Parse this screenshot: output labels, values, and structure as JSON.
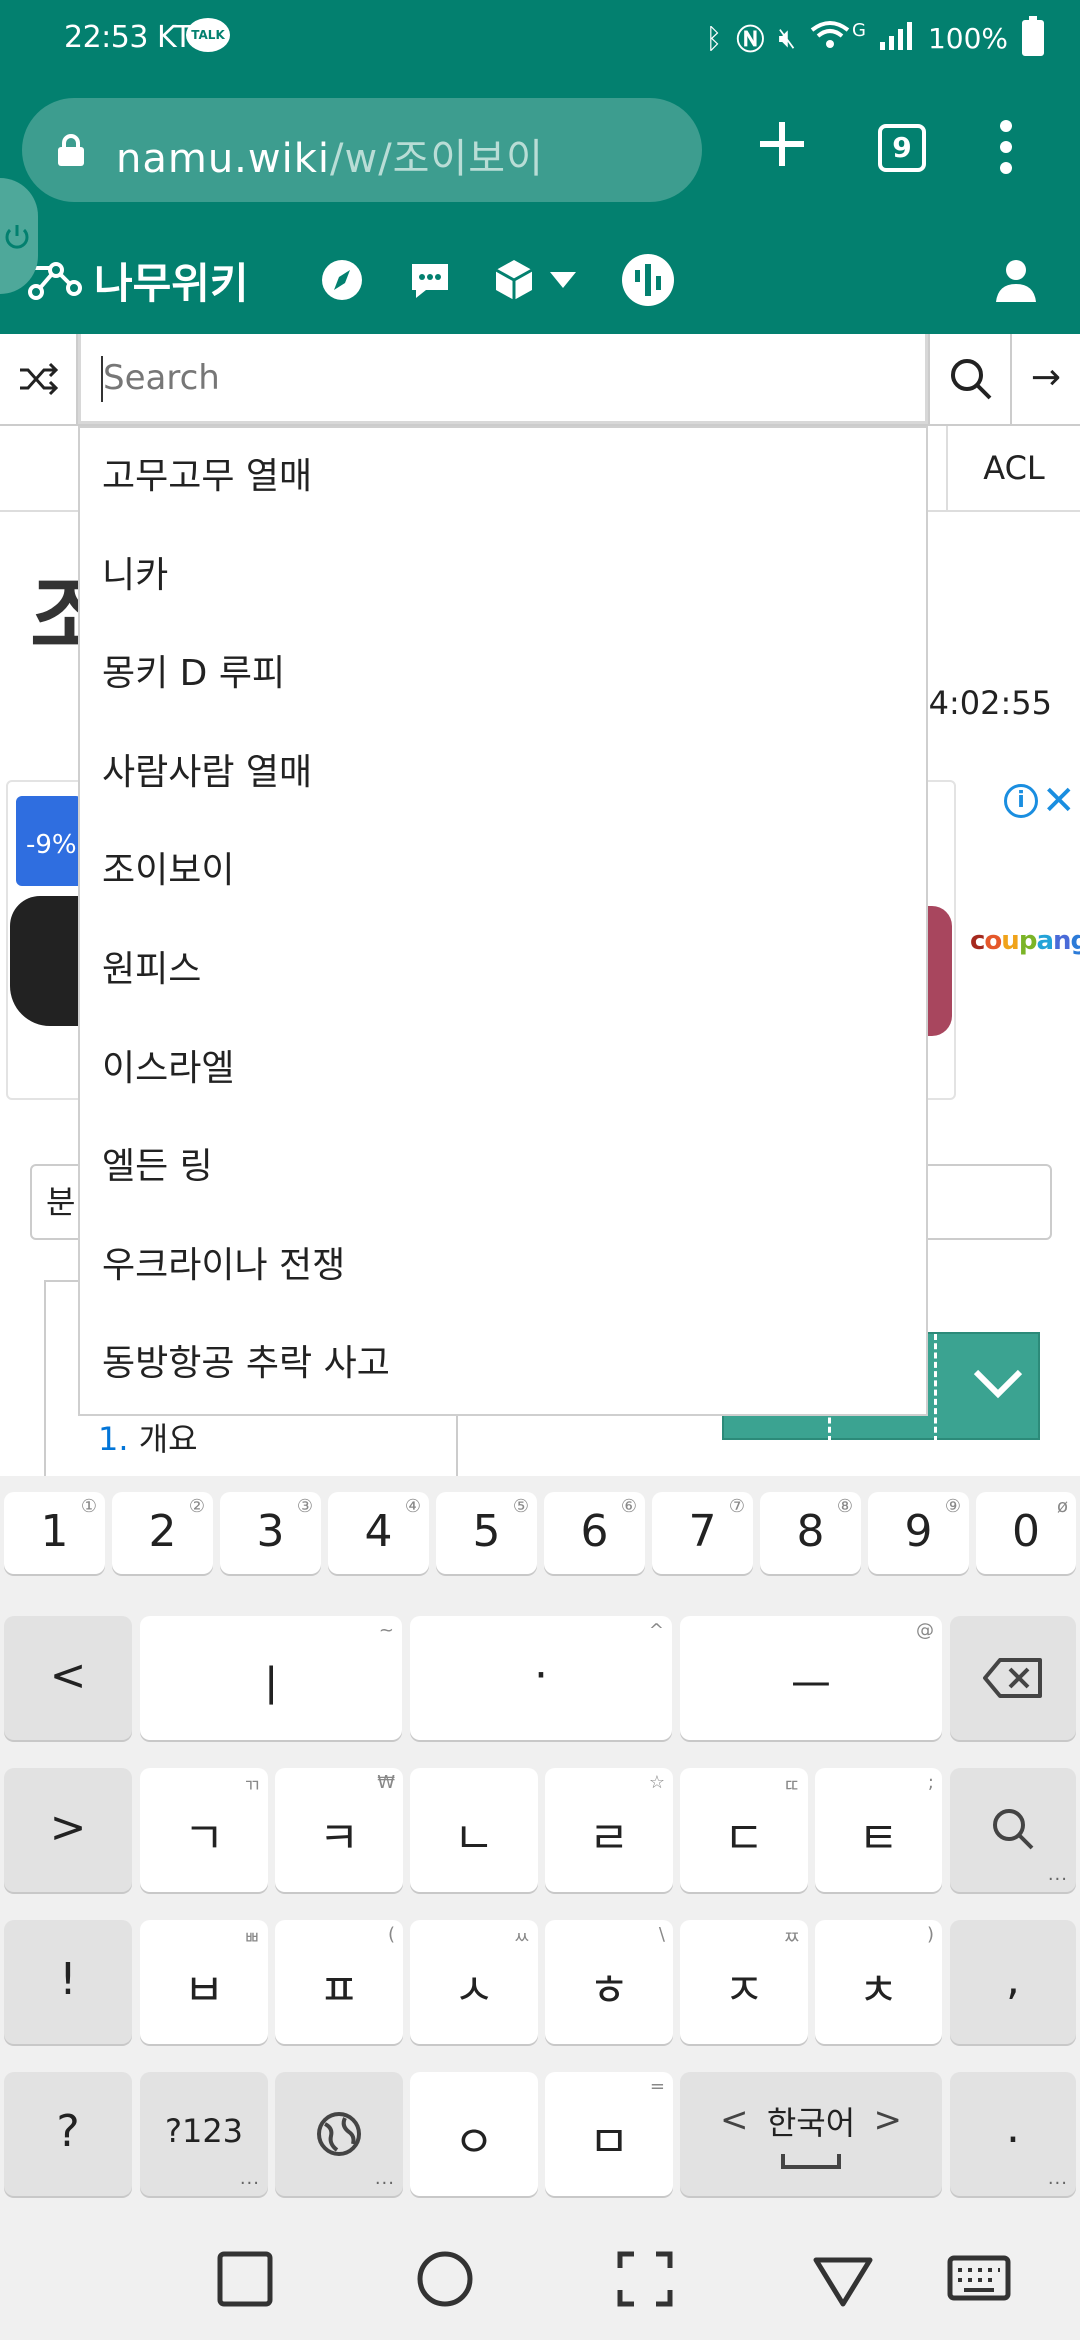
{
  "status_bar": {
    "time": "22:53",
    "carrier": "KT",
    "talk_badge": "TALK",
    "network_label": "G",
    "battery": "100%"
  },
  "browser": {
    "url_host": "namu.wiki",
    "url_path": "/w/조이보이",
    "tab_count": "9"
  },
  "wiki_nav": {
    "logo_text": "나무위키",
    "icons": [
      "compass-icon",
      "chat-icon",
      "cube-icon",
      "dropdown-caret-icon",
      "thetree-icon",
      "user-icon"
    ]
  },
  "search": {
    "placeholder": "Search",
    "value": "",
    "go_arrow": "→"
  },
  "page_behind": {
    "acl_label": "ACL",
    "title_partial": "조",
    "last_edit_time": "4:02:55",
    "category_partial": "분",
    "toc_first_number": "1.",
    "toc_first_label": "개요",
    "ad": {
      "discount": "-9%",
      "brand": [
        "c",
        "o",
        "u",
        "p",
        "a",
        "n",
        "g"
      ],
      "info": "i",
      "close": "✕"
    }
  },
  "suggestions": [
    "고무고무 열매",
    "니카",
    "몽키 D 루피",
    "사람사람 열매",
    "조이보이",
    "원피스",
    "이스라엘",
    "엘든 링",
    "우크라이나 전쟁",
    "동방항공 추락 사고"
  ],
  "keyboard": {
    "number_row": [
      {
        "label": "1",
        "hint": "①"
      },
      {
        "label": "2",
        "hint": "②"
      },
      {
        "label": "3",
        "hint": "③"
      },
      {
        "label": "4",
        "hint": "④"
      },
      {
        "label": "5",
        "hint": "⑤"
      },
      {
        "label": "6",
        "hint": "⑥"
      },
      {
        "label": "7",
        "hint": "⑦"
      },
      {
        "label": "8",
        "hint": "⑧"
      },
      {
        "label": "9",
        "hint": "⑨"
      },
      {
        "label": "0",
        "hint": "ø"
      }
    ],
    "row2": [
      {
        "label": "<",
        "hint": "",
        "dark": true
      },
      {
        "label": "ㅣ",
        "hint": "~"
      },
      {
        "label": "·",
        "hint": "^"
      },
      {
        "label": "ㅡ",
        "hint": "@"
      },
      {
        "label": "⌫",
        "hint": "",
        "dark": true
      }
    ],
    "row3": [
      {
        "label": ">",
        "hint": "",
        "dark": true
      },
      {
        "label": "ㄱ",
        "hint": "ㄲ"
      },
      {
        "label": "ㅋ",
        "hint": "₩"
      },
      {
        "label": "ㄴ",
        "hint": ""
      },
      {
        "label": "ㄹ",
        "hint": "☆"
      },
      {
        "label": "ㄷ",
        "hint": "ㄸ"
      },
      {
        "label": "ㅌ",
        "hint": ";"
      },
      {
        "label": "search",
        "hint": "",
        "dark": true
      }
    ],
    "row4": [
      {
        "label": "!",
        "hint": "",
        "dark": true
      },
      {
        "label": "ㅂ",
        "hint": "ㅃ"
      },
      {
        "label": "ㅍ",
        "hint": "("
      },
      {
        "label": "ㅅ",
        "hint": "ㅆ"
      },
      {
        "label": "ㅎ",
        "hint": "\\"
      },
      {
        "label": "ㅈ",
        "hint": "ㅉ"
      },
      {
        "label": "ㅊ",
        "hint": ")"
      },
      {
        "label": ",",
        "hint": "",
        "dark": true
      }
    ],
    "row5": [
      {
        "label": "?",
        "hint": "",
        "dark": true
      },
      {
        "label": "?123",
        "hint": "",
        "dark": true
      },
      {
        "label": "globe",
        "hint": "",
        "dark": true
      },
      {
        "label": "ㅇ",
        "hint": ""
      },
      {
        "label": "ㅁ",
        "hint": "="
      },
      {
        "label": "한국어",
        "hint": "",
        "dark": true
      },
      {
        "label": ".",
        "hint": "",
        "dark": true
      }
    ],
    "space_arrows": [
      "<",
      ">"
    ]
  },
  "colors": {
    "brand_green": "#03806f",
    "url_pill": "#3d9d8f",
    "toggle_teal": "#3ba391",
    "link_blue": "#0275d8"
  }
}
